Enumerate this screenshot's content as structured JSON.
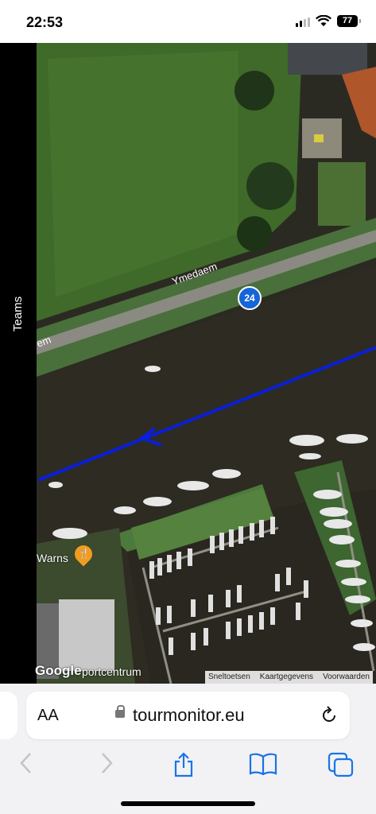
{
  "status": {
    "time": "22:53",
    "battery": "77"
  },
  "map": {
    "teams_label": "Teams",
    "marker_number": "24",
    "road_name": "Ymedaem",
    "road_name_fragment": "em",
    "poi_name": "Warns",
    "google_logo": "Google",
    "sport_label": "portcentrum",
    "attribution": [
      "Sneltoetsen",
      "Kaartgegevens",
      "Voorwaarden"
    ],
    "route_color": "#0a1fd6"
  },
  "browser": {
    "text_size_button": "AA",
    "url": "tourmonitor.eu"
  },
  "icons": [
    "signal-icon",
    "wifi-icon",
    "battery-icon",
    "lock-icon",
    "reload-icon",
    "back-icon",
    "forward-icon",
    "share-icon",
    "bookmarks-icon",
    "tabs-icon",
    "restaurant-icon"
  ]
}
